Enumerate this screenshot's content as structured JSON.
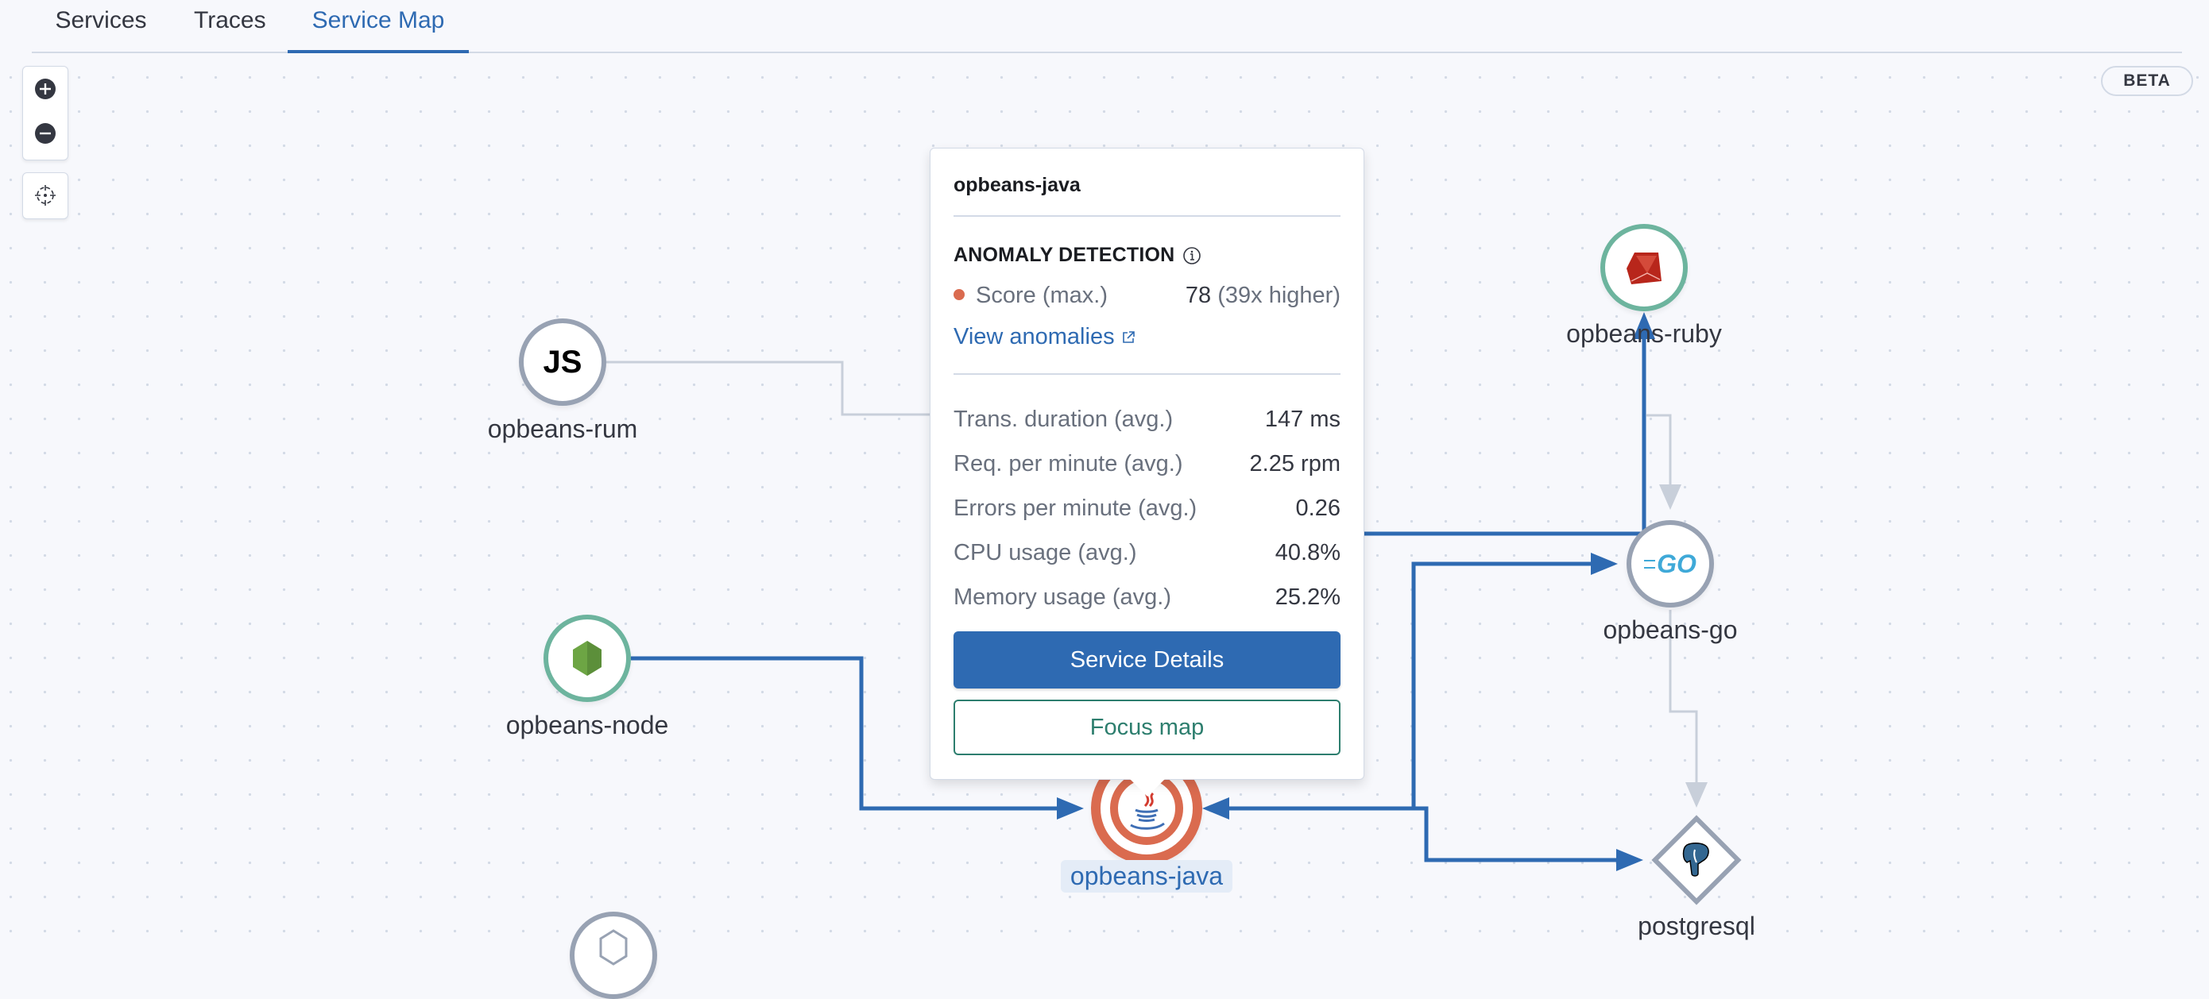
{
  "tabs": [
    {
      "label": "Services",
      "active": false
    },
    {
      "label": "Traces",
      "active": false
    },
    {
      "label": "Service Map",
      "active": true
    }
  ],
  "controls": {
    "zoom_in_icon": "plus-circle-icon",
    "zoom_out_icon": "minus-circle-icon",
    "center_icon": "crosshair-icon"
  },
  "badge": "BETA",
  "colors": {
    "accent": "#2E6AB2",
    "anomaly": "#DA6B4F",
    "healthy": "#6DB49E",
    "neutral": "#98A2B3",
    "edge_inactive": "#C8CFDA",
    "focus_green": "#2D7E6E"
  },
  "nodes": [
    {
      "id": "opbeans-rum",
      "label": "opbeans-rum",
      "icon": "javascript-icon",
      "icon_text": "JS",
      "health": "neutral"
    },
    {
      "id": "opbeans-node",
      "label": "opbeans-node",
      "icon": "nodejs-icon",
      "health": "healthy"
    },
    {
      "id": "opbeans-java",
      "label": "opbeans-java",
      "icon": "java-icon",
      "health": "critical",
      "selected": true
    },
    {
      "id": "opbeans-ruby",
      "label": "opbeans-ruby",
      "icon": "ruby-icon",
      "health": "healthy"
    },
    {
      "id": "opbeans-go",
      "label": "opbeans-go",
      "icon": "go-icon",
      "icon_text": "GO",
      "health": "neutral"
    },
    {
      "id": "postgresql",
      "label": "postgresql",
      "icon": "postgresql-icon",
      "type": "external"
    },
    {
      "id": "unnamed-bottom",
      "label": "",
      "icon": "hexagon-icon",
      "health": "neutral"
    }
  ],
  "edges": [
    {
      "from": "opbeans-rum",
      "to": "opbeans-java",
      "highlighted": false
    },
    {
      "from": "opbeans-node",
      "to": "opbeans-java",
      "highlighted": true
    },
    {
      "from": "opbeans-java",
      "to": "opbeans-ruby",
      "highlighted": true
    },
    {
      "from": "opbeans-java",
      "to": "opbeans-go",
      "highlighted": true
    },
    {
      "from": "opbeans-go",
      "to": "opbeans-java",
      "highlighted": true
    },
    {
      "from": "opbeans-java",
      "to": "postgresql",
      "highlighted": true
    },
    {
      "from": "opbeans-ruby",
      "to": "opbeans-go",
      "highlighted": false
    },
    {
      "from": "opbeans-go",
      "to": "postgresql",
      "highlighted": false
    }
  ],
  "popover": {
    "title": "opbeans-java",
    "anomaly": {
      "heading": "ANOMALY DETECTION",
      "score_label": "Score (max.)",
      "score_value": "78",
      "score_detail": "(39x higher)",
      "link": "View anomalies"
    },
    "metrics": [
      {
        "label": "Trans. duration (avg.)",
        "value": "147 ms"
      },
      {
        "label": "Req. per minute (avg.)",
        "value": "2.25 rpm"
      },
      {
        "label": "Errors per minute (avg.)",
        "value": "0.26"
      },
      {
        "label": "CPU usage (avg.)",
        "value": "40.8%"
      },
      {
        "label": "Memory usage (avg.)",
        "value": "25.2%"
      }
    ],
    "primary_button": "Service Details",
    "secondary_button": "Focus map"
  }
}
